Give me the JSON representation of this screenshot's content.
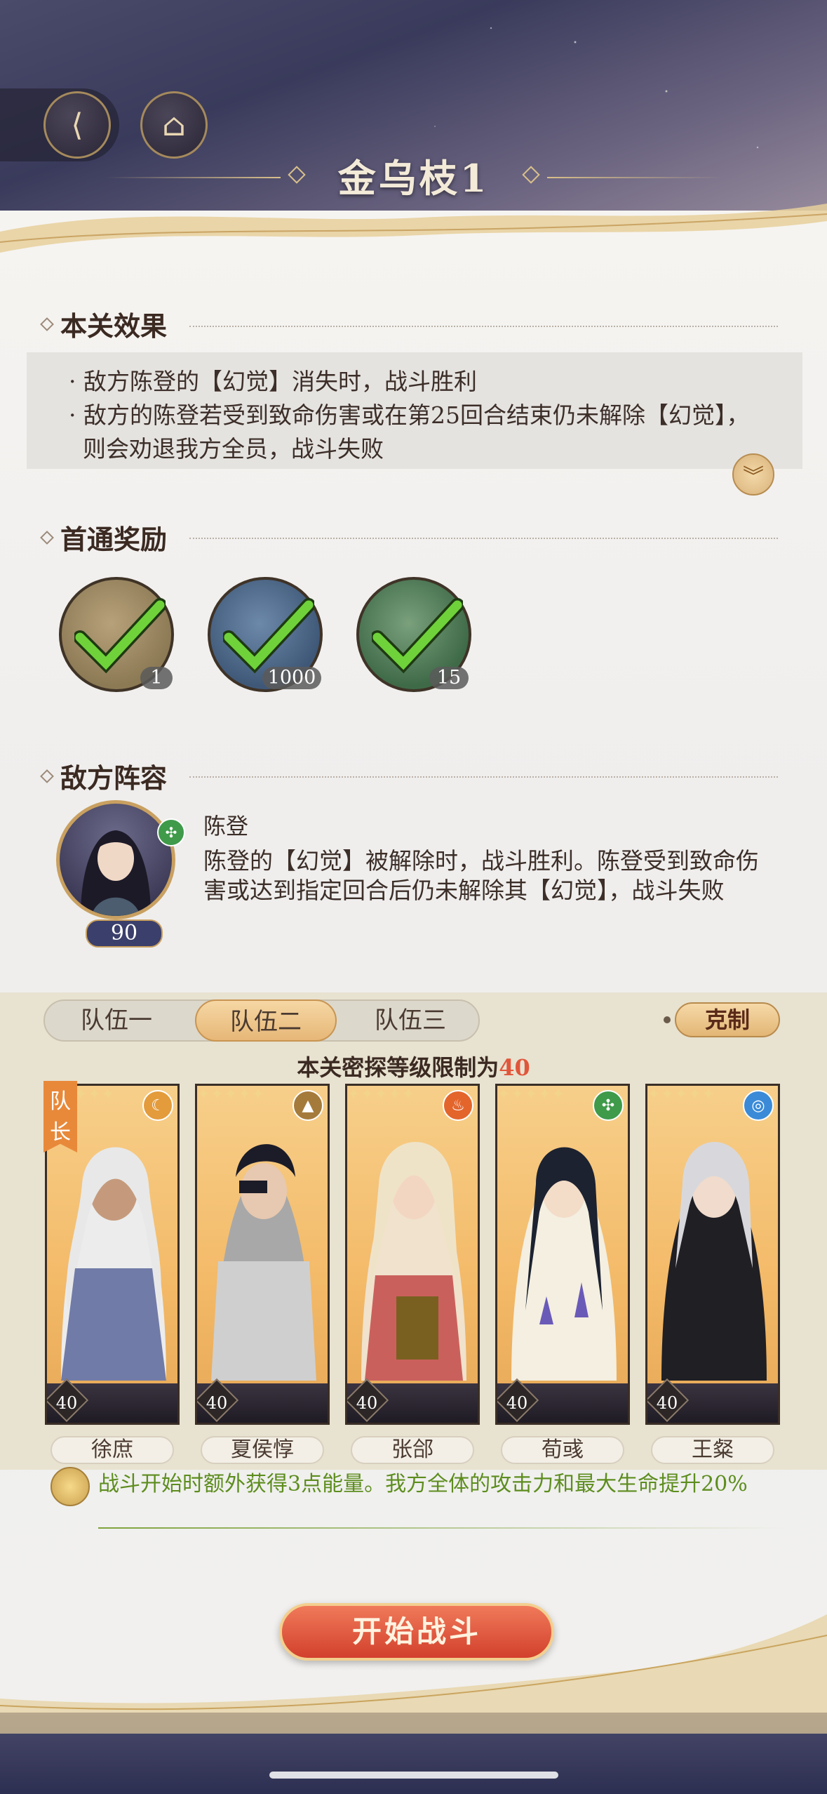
{
  "header": {
    "title": "金乌枝1",
    "back_icon": "back-arrow-icon",
    "home_icon": "pavilion-icon"
  },
  "effects": {
    "heading": "本关效果",
    "items": [
      "· 敌方陈登的【幻觉】消失时，战斗胜利",
      "· 敌方的陈登若受到致命伤害或在第25回合结束仍未解除【幻觉】，则会劝退我方全员，战斗失败"
    ],
    "expand_icon": "double-chevron-down-icon"
  },
  "rewards": {
    "heading": "首通奖励",
    "items": [
      {
        "icon": "token-plaque-icon",
        "count": "1",
        "claimed": true,
        "color": "#8c7a55"
      },
      {
        "icon": "dragon-jade-icon",
        "count": "1000",
        "claimed": true,
        "color": "#4d6a8c"
      },
      {
        "icon": "clay-jar-icon",
        "count": "15",
        "claimed": true,
        "color": "#4f7a56"
      }
    ]
  },
  "enemy": {
    "heading": "敌方阵容",
    "name": "陈登",
    "level": "90",
    "element": "wind",
    "description": "陈登的【幻觉】被解除时，战斗胜利。陈登受到致命伤害或达到指定回合后仍未解除其【幻觉】，战斗失败"
  },
  "team": {
    "tabs": [
      "队伍一",
      "队伍二",
      "队伍三"
    ],
    "active_tab": 1,
    "counter_label": "克制",
    "level_limit_prefix": "本关密探等级限制为",
    "level_limit_value": "40",
    "leader_label": "队\n长",
    "members": [
      {
        "name": "徐庶",
        "level": "40",
        "element": "moon",
        "elem_color": "#e39b3c",
        "elem_glyph": "☾"
      },
      {
        "name": "夏侯惇",
        "level": "40",
        "element": "mountain",
        "elem_color": "#a57b3c",
        "elem_glyph": "▲"
      },
      {
        "name": "张郃",
        "level": "40",
        "element": "fire",
        "elem_color": "#e3652c",
        "elem_glyph": "♨"
      },
      {
        "name": "荀彧",
        "level": "40",
        "element": "wind",
        "elem_color": "#3f9a4a",
        "elem_glyph": "✣"
      },
      {
        "name": "王粲",
        "level": "40",
        "element": "water",
        "elem_color": "#3a8ad8",
        "elem_glyph": "◎"
      }
    ],
    "stars": "✦✦✦✦✦"
  },
  "buff": {
    "icon": "gold-emblem-icon",
    "text": "战斗开始时额外获得3点能量。我方全体的攻击力和最大生命提升20%"
  },
  "start_button": {
    "label": "开始战斗"
  },
  "colors": {
    "accent": "#d2402c",
    "buff_text": "#5d8d1e",
    "limit_number": "#e0563b"
  }
}
